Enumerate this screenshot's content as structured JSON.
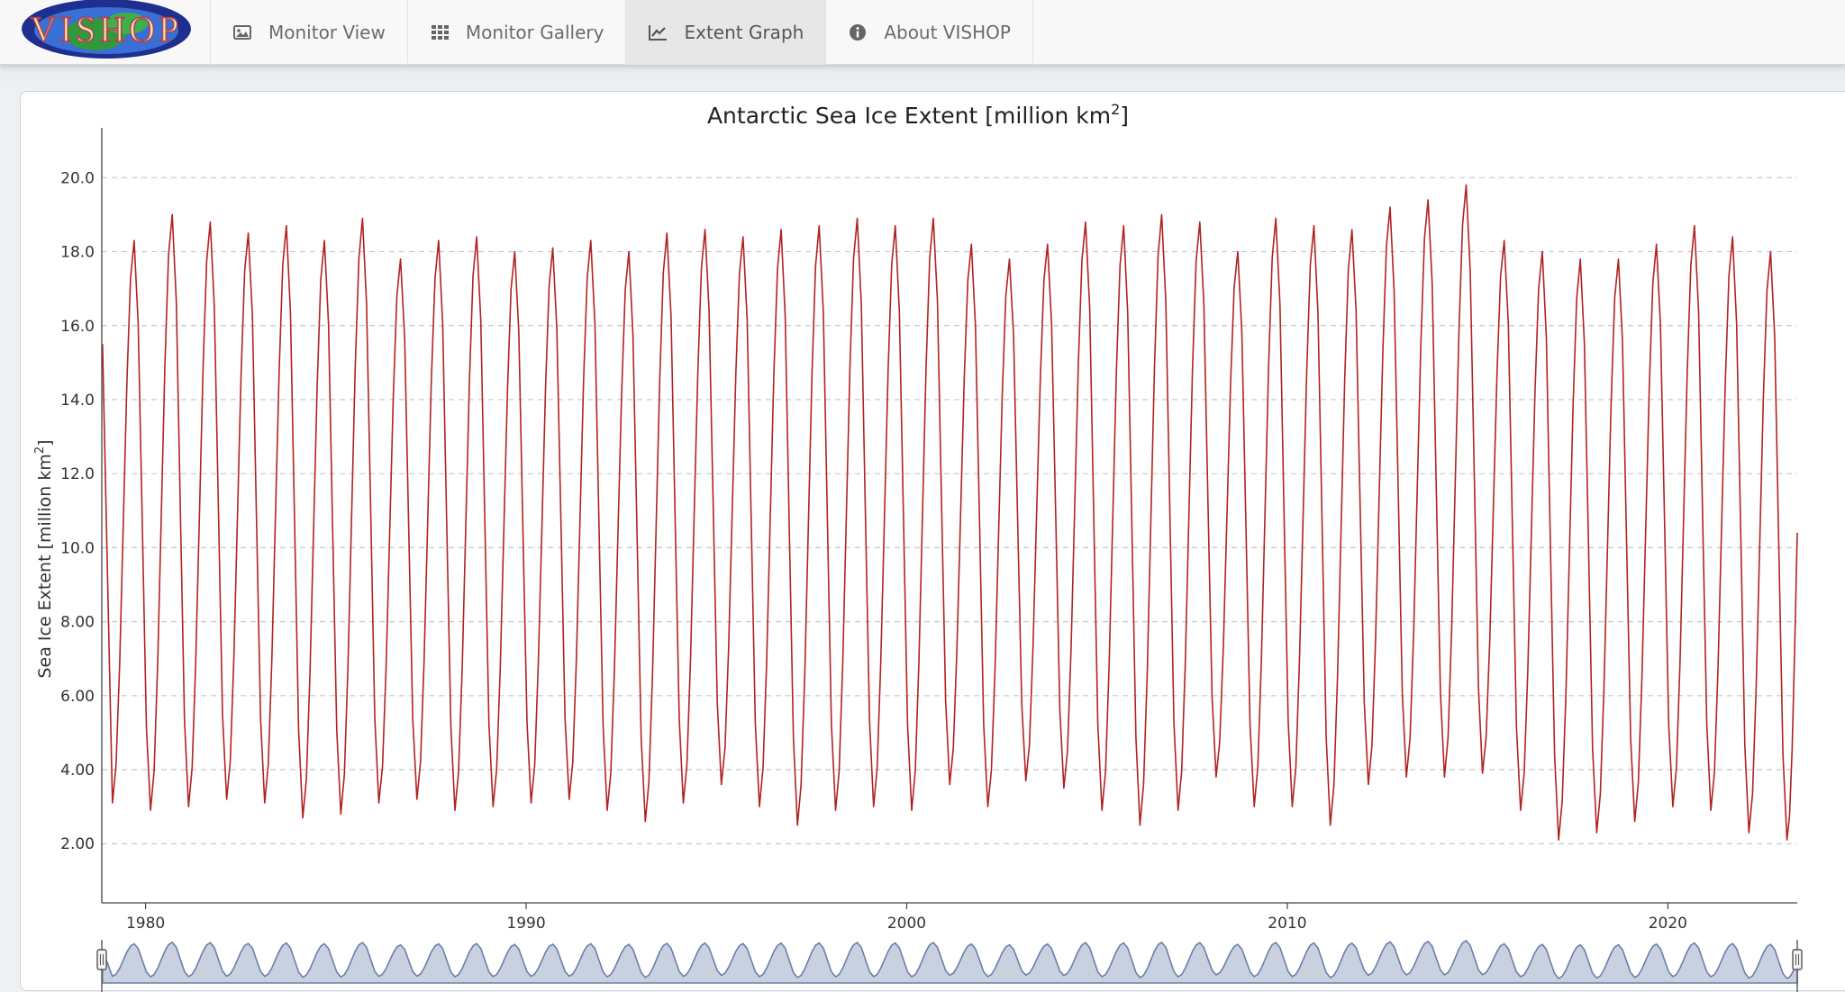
{
  "nav": {
    "logo_text": "VISHOP",
    "tabs": [
      {
        "label": "Monitor View",
        "icon": "image-icon"
      },
      {
        "label": "Monitor Gallery",
        "icon": "grid-icon"
      },
      {
        "label": "Extent Graph",
        "icon": "line-chart-icon",
        "active": true
      },
      {
        "label": "About VISHOP",
        "icon": "info-icon"
      }
    ]
  },
  "colors": {
    "series": "#b22222",
    "navigator_fill": "#c9d1e0",
    "navigator_line": "#6a7fa8",
    "grid": "#c8c8c8"
  },
  "chart_data": {
    "type": "line",
    "title": "Antarctic Sea Ice Extent [million km",
    "title_sup": "2",
    "title_end": "]",
    "ylabel": "Sea Ice Extent [million km",
    "ylabel_sup": "2",
    "ylabel_end": "]",
    "ylim": [
      0.4,
      21.2
    ],
    "yticks": [
      "2.00",
      "4.00",
      "6.00",
      "8.00",
      "10.0",
      "12.0",
      "14.0",
      "16.0",
      "18.0",
      "20.0"
    ],
    "ytick_values": [
      2,
      4,
      6,
      8,
      10,
      12,
      14,
      16,
      18,
      20
    ],
    "xlim": [
      1978.85,
      2023.4
    ],
    "xticks": [
      "1980",
      "1990",
      "2000",
      "2010",
      "2020"
    ],
    "xtick_values": [
      1980,
      1990,
      2000,
      2010,
      2020
    ],
    "grid": true,
    "series": [
      {
        "annual_cycle_note_free": true,
        "year_start": 1979,
        "data_start": 1978.87,
        "data_start_value": 15.5,
        "data_end": 2023.4,
        "data_end_value": 10.4,
        "annual_max": [
          18.3,
          19.0,
          18.8,
          18.5,
          18.7,
          18.3,
          18.9,
          17.8,
          18.3,
          18.4,
          18.0,
          18.1,
          18.3,
          18.0,
          18.5,
          18.6,
          18.4,
          18.6,
          18.7,
          18.9,
          18.7,
          18.9,
          18.2,
          17.8,
          18.2,
          18.8,
          18.7,
          19.0,
          18.8,
          18.0,
          18.9,
          18.7,
          18.6,
          19.2,
          19.4,
          19.8,
          18.3,
          18.0,
          17.8,
          17.8,
          18.2,
          18.7,
          18.4,
          18.0
        ],
        "annual_min": [
          3.1,
          2.9,
          3.0,
          3.2,
          3.1,
          2.7,
          2.8,
          3.1,
          3.2,
          2.9,
          3.0,
          3.1,
          3.2,
          2.9,
          2.6,
          3.1,
          3.6,
          3.0,
          2.5,
          2.9,
          3.0,
          2.9,
          3.6,
          3.0,
          3.7,
          3.5,
          2.9,
          2.5,
          2.9,
          3.8,
          3.0,
          3.0,
          2.5,
          3.6,
          3.8,
          3.8,
          3.9,
          2.9,
          2.1,
          2.3,
          2.6,
          3.0,
          2.9,
          2.3,
          2.1
        ]
      }
    ]
  }
}
